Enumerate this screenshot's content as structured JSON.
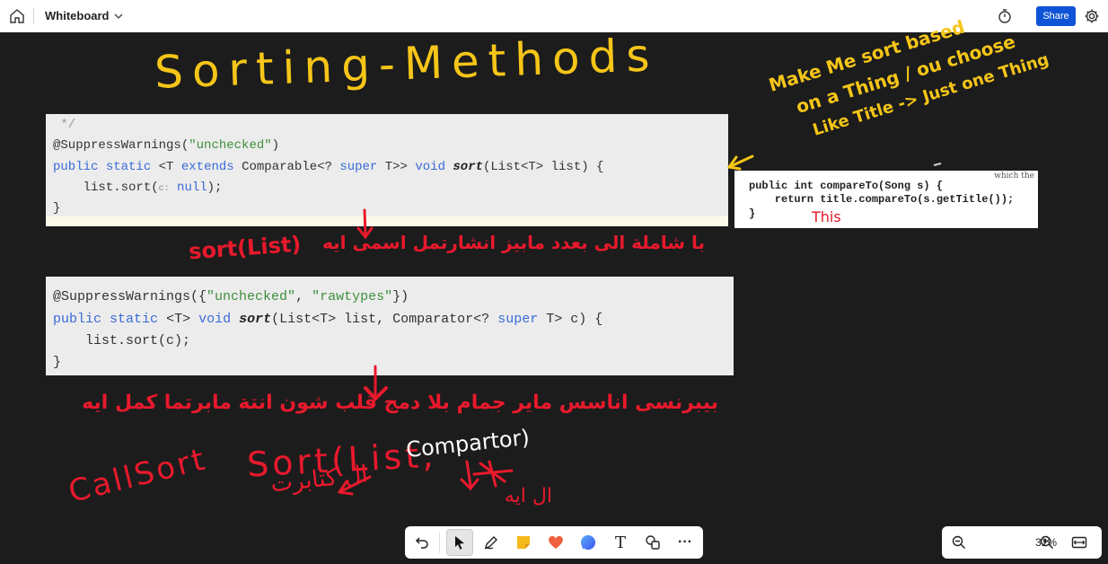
{
  "app": {
    "title": "Whiteboard",
    "share_label": "Share"
  },
  "handwriting": {
    "title": "Sorting-Methods",
    "note_top_right": [
      "Make Me sort based",
      "on a Thing / ou choose",
      "Like Title -> Just one Thing"
    ],
    "note_this": "This",
    "note_sort_list": "sort(List)",
    "note_arabic_1": "با شاملة الى بعدد مابيز انشارتمل اسمى ايه",
    "note_arabic_2": "بيبرنسى اناسس ماير جمام بلا دمج قلب شون انتة مابرتما كمل ايه وعدة",
    "note_sort_list2": "Sort(List,",
    "note_comparator": "Compartor)",
    "note_arabic_3": "ال كتابرت",
    "note_arabic_4": "ال ايه",
    "note_call_sort": "CallSort"
  },
  "code1": {
    "comment": " */",
    "l1_anno": "@SuppressWarnings(",
    "l1_str": "\"unchecked\"",
    "l1_end": ")",
    "l2_public": "public",
    "l2_static": "static",
    "l2_a": "<T",
    "l2_extends": "extends",
    "l2_b": "Comparable<?",
    "l2_super": "super",
    "l2_c": "T>>",
    "l2_void": "void",
    "l2_sort": "sort",
    "l2_d": "(List<T> list) {",
    "l3_a": "    list.sort(",
    "l3_hint": "c:",
    "l3_null": "null",
    "l3_end": ");",
    "l4": "}"
  },
  "code2": {
    "l1_anno": "@SuppressWarnings({",
    "l1_s1": "\"unchecked\"",
    "l1_comma": ", ",
    "l1_s2": "\"rawtypes\"",
    "l1_end": "})",
    "l2_public": "public",
    "l2_static": "static",
    "l2_t": "<T>",
    "l2_void": "void",
    "l2_sort": "sort",
    "l2_a": "(List<T> list, Comparator<?",
    "l2_super": "super",
    "l2_b": "T> c) {",
    "l3": "    list.sort(c);",
    "l4": "}"
  },
  "code3": {
    "corner": "which the",
    "l1": "public int compareTo(Song s) {",
    "l2": "    return title.compareTo(s.getTitle());",
    "l3": "}"
  },
  "toolbar": {
    "undo": "undo-icon",
    "select": "pointer-icon",
    "pen": "pen-icon",
    "note": "sticky-note-icon",
    "reaction": "heart-icon",
    "comment": "comment-icon",
    "text": "T",
    "shapes": "shapes-icon",
    "more": "···"
  },
  "zoom": {
    "value": "31%"
  },
  "colors": {
    "accent": "#0f54d6",
    "yellow_ink": "#f5c518",
    "red_ink": "#e8192c",
    "white_ink": "#ffffff"
  }
}
